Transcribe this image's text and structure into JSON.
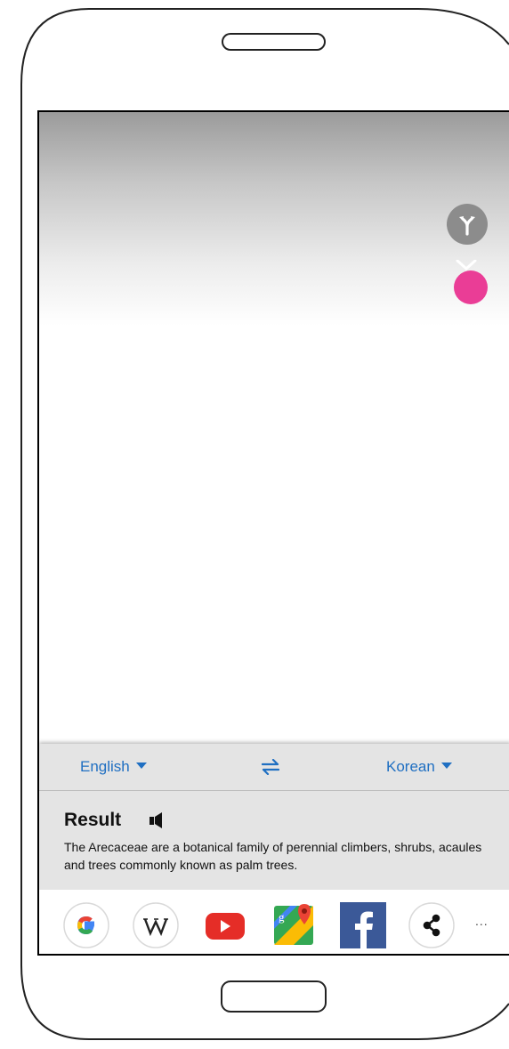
{
  "camera": {
    "split_button_icon": "split-arrows-icon",
    "indicator_icon": "chevron-down-icon",
    "capture_color": "#ea3d96"
  },
  "translator": {
    "source_language": "English",
    "target_language": "Korean",
    "swap_icon": "swap-arrows-icon",
    "accent_color": "#1f6fc2"
  },
  "result": {
    "title": "Result",
    "speaker_icon": "speaker-icon",
    "text": "The Arecaceae are a botanical family of perennial climbers, shrubs, acaules and trees commonly known as palm trees."
  },
  "share_apps": [
    {
      "icon": "google-icon"
    },
    {
      "icon": "wikipedia-icon"
    },
    {
      "icon": "youtube-icon"
    },
    {
      "icon": "google-maps-icon"
    },
    {
      "icon": "facebook-icon"
    },
    {
      "icon": "share-icon"
    }
  ],
  "more_label": "..."
}
